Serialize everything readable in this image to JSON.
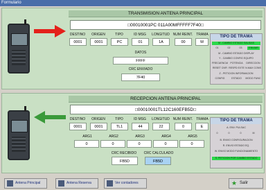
{
  "window": {
    "title": "Formulario"
  },
  "transmision": {
    "title": "TRANSMISION ANTENA PRINCIPAL",
    "frame": "□00010001PC 011A00MFFFFF7F40□",
    "headers": [
      "DESTINO",
      "ORIGEN",
      "TIPO",
      "ID MSG",
      "LONGITUD",
      "NUM REINT.",
      "TRAMA"
    ],
    "values": [
      "0001",
      "0001",
      "PC",
      "01",
      "1A",
      "00",
      "M"
    ],
    "datos_label": "DATOS",
    "datos_value": "FFFF",
    "crc_label": "CRC ENVIADO",
    "crc_value": "7F40",
    "tipo": {
      "title": "TIPO DE TRAMA",
      "items": [
        "M - CAMBIO ESTADO SALIDAS",
        "01",
        "02",
        "03",
        "ENVIAR",
        "M - CAMBIO ESTADO DISPLAY",
        "Y - CAMBIO CONFIG EQUIPO",
        "FRECUENCIA",
        "POTENCIA",
        "DIRECCION",
        "RESET CNFI",
        "RESPD EXTE",
        "N.MAX CONS",
        "Z - PETICION INFORMACION",
        "CONFIG",
        "ESTADO",
        "MODO FUNC"
      ]
    }
  },
  "recepcion": {
    "title": "RECEPCION ANTENA PRINCIPAL",
    "frame": "□00010001TL12C160EFB5D□",
    "headers": [
      "DESTINO",
      "ORIGEN",
      "TIPO",
      "ID MSG",
      "LONGITUD",
      "NUM REINT.",
      "TRAMA"
    ],
    "values": [
      "0001",
      "0001",
      "TL1",
      "44",
      "22",
      "0",
      "E"
    ],
    "arg_headers": [
      "ARG1",
      "ARG2",
      "ARG3",
      "ARG4",
      "ARG5"
    ],
    "arg_values": [
      "0",
      "0",
      "0",
      "0",
      "0"
    ],
    "crc_recibido_label": "CRC RECIBIDO",
    "crc_recibido_value": "FB5D",
    "crc_calculado_label": "CRC CALCULADO",
    "crc_calculado_value": "FB5D",
    "tipo": {
      "title": "TIPO DE TRAMA",
      "items": [
        "A. ENV. PULSAC",
        "0",
        "0",
        "0",
        "M",
        "B. ENVIO CONFIGURACION",
        "R. ENVIO ESTADO EQ.",
        "W. ENVIO MODO FUNCIONAMIENTO",
        "S. PETICION POR CAMBIO ESTADO"
      ]
    }
  },
  "taskbar": {
    "buttons": [
      "Antena Principal",
      "Antena Reserva",
      "Ver contadores",
      "Salir"
    ]
  },
  "colors": {
    "panel": "#c9e0c4",
    "header": "#a9c7a6",
    "highlight": "#2cd84a",
    "blue_value": "#a9d2f3",
    "tx_arrow": "#e4211b",
    "rx_arrow": "#3a9a3a"
  }
}
